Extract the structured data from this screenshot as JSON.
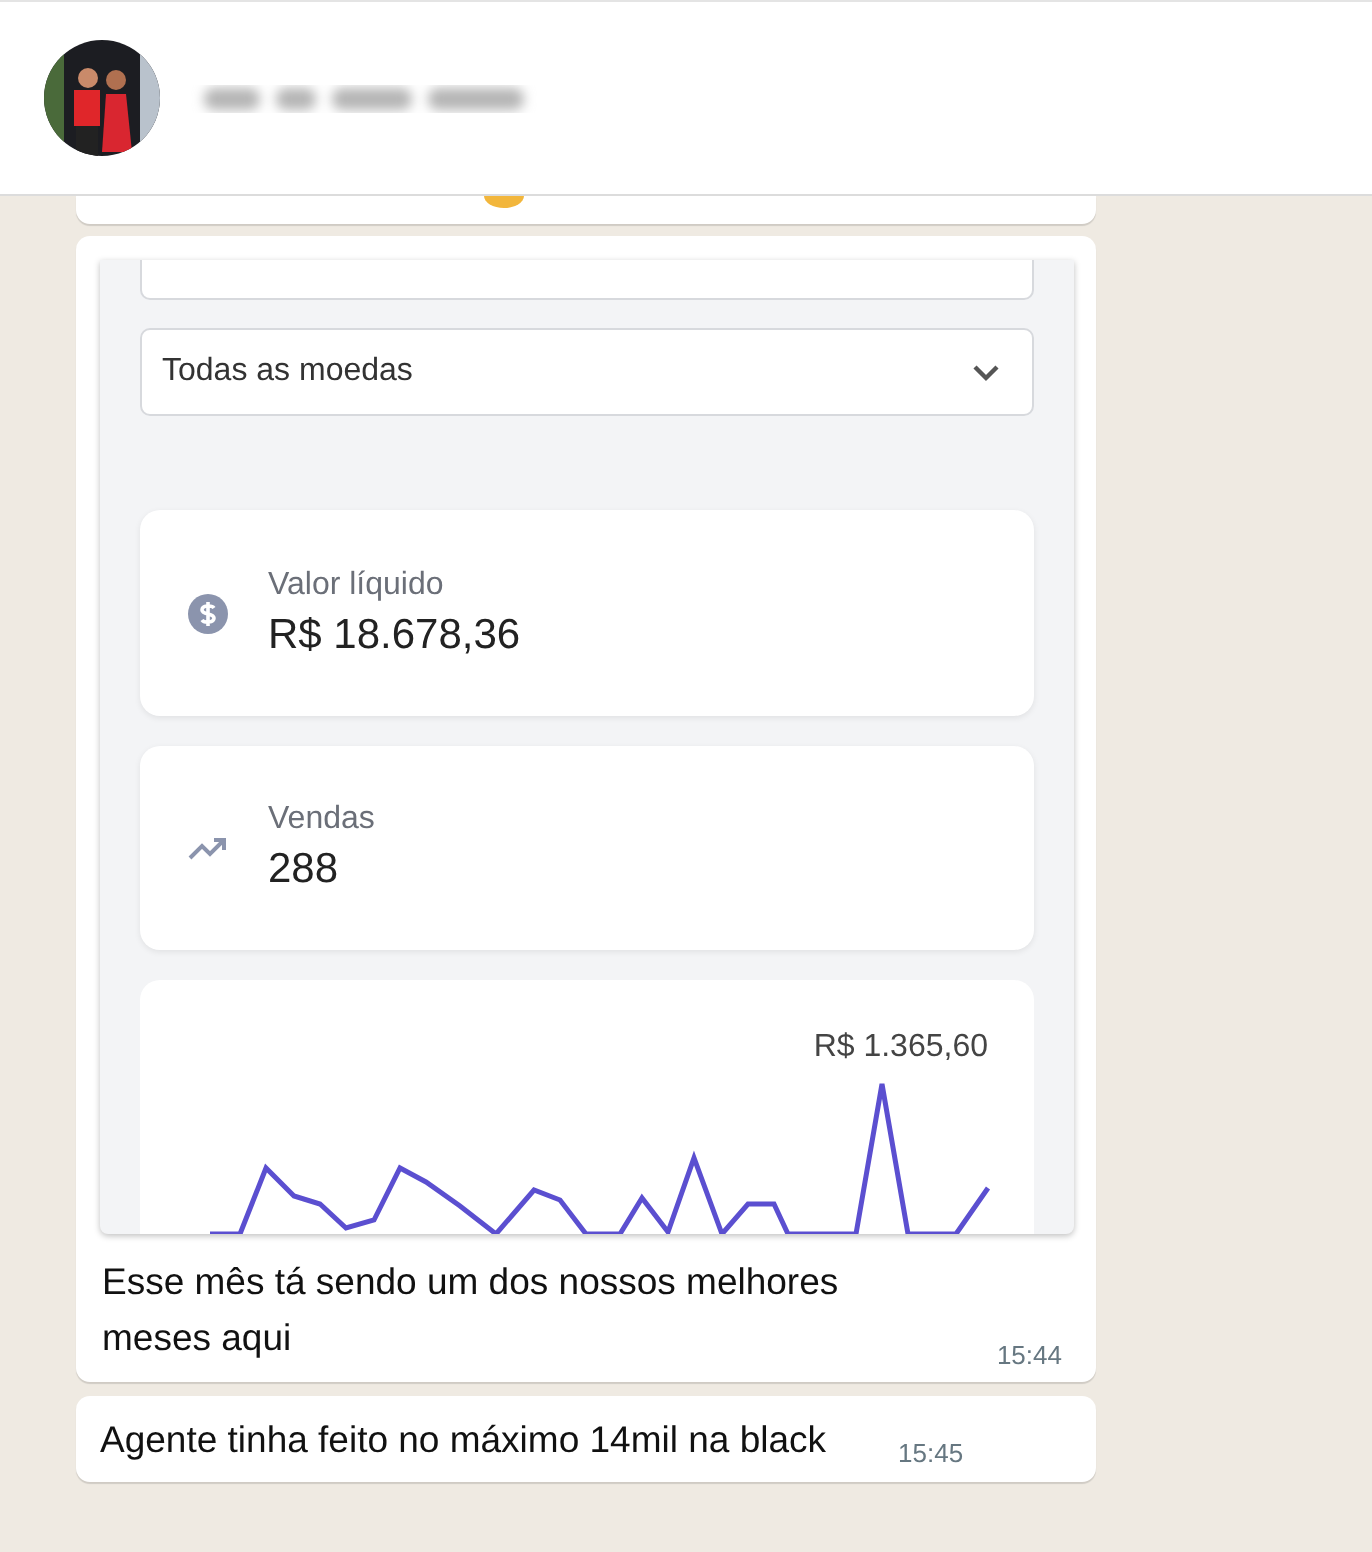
{
  "messages": [
    {
      "kind": "cut"
    },
    {
      "screenshot": {
        "currency_select": {
          "value": "Todas as moedas"
        },
        "stats": [
          {
            "kind": "dollar",
            "label": "Valor líquido",
            "value": "R$ 18.678,36"
          },
          {
            "kind": "trend",
            "label": "Vendas",
            "value": "288"
          }
        ],
        "chart": {
          "peak_label": "R$ 1.365,60"
        }
      },
      "text": "Esse mês tá sendo um dos nossos melhores meses aqui",
      "time": "15:44"
    },
    {
      "kind": "text",
      "text": "Agente tinha feito no máximo 14mil na black",
      "time": "15:45"
    }
  ]
}
